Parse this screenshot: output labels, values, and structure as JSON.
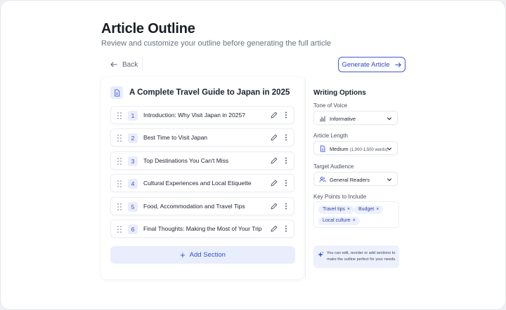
{
  "header": {
    "title": "Article Outline",
    "subtitle": "Review and customize your outline before generating the full article"
  },
  "toolbar": {
    "back_label": "Back",
    "generate_label": "Generate Article"
  },
  "outline": {
    "title": "A Complete Travel Guide to Japan in 2025",
    "sections": [
      {
        "number": "1",
        "label": "Introduction: Why Visit Japan in 2025?"
      },
      {
        "number": "2",
        "label": "Best Time to Visit Japan"
      },
      {
        "number": "3",
        "label": "Top Destinations You Can't Miss"
      },
      {
        "number": "4",
        "label": "Cultural Experiences and Local Etiquette"
      },
      {
        "number": "5",
        "label": "Food, Accommodation and Travel Tips"
      },
      {
        "number": "6",
        "label": "Final Thoughts: Making the Most of Your Trip"
      }
    ],
    "add_section_label": "Add Section"
  },
  "options": {
    "title": "Writing Options",
    "tone_label": "Tone of Voice",
    "tone_value": "Informative",
    "length_label": "Article Length",
    "length_value": "Medium",
    "length_detail": "(1,000-1,500 words)",
    "audience_label": "Target Audience",
    "audience_value": "General Readers",
    "keypoints_label": "Key Points to Include",
    "keypoints": [
      "Travel tips",
      "Budget",
      "Local culture"
    ],
    "tip": "You can edit, reorder or add sections to make the outline perfect for your needs."
  },
  "colors": {
    "accent": "#3f5bd8",
    "accent_soft": "#e8eefc",
    "text": "#1f2430",
    "muted": "#6a7282"
  },
  "icons": [
    "arrow-left-icon",
    "arrow-right-icon",
    "document-icon",
    "drag-handle-icon",
    "pencil-icon",
    "more-vertical-icon",
    "plus-icon",
    "bar-chart-icon",
    "users-icon",
    "chevron-down-icon",
    "close-icon",
    "sparkle-icon"
  ]
}
